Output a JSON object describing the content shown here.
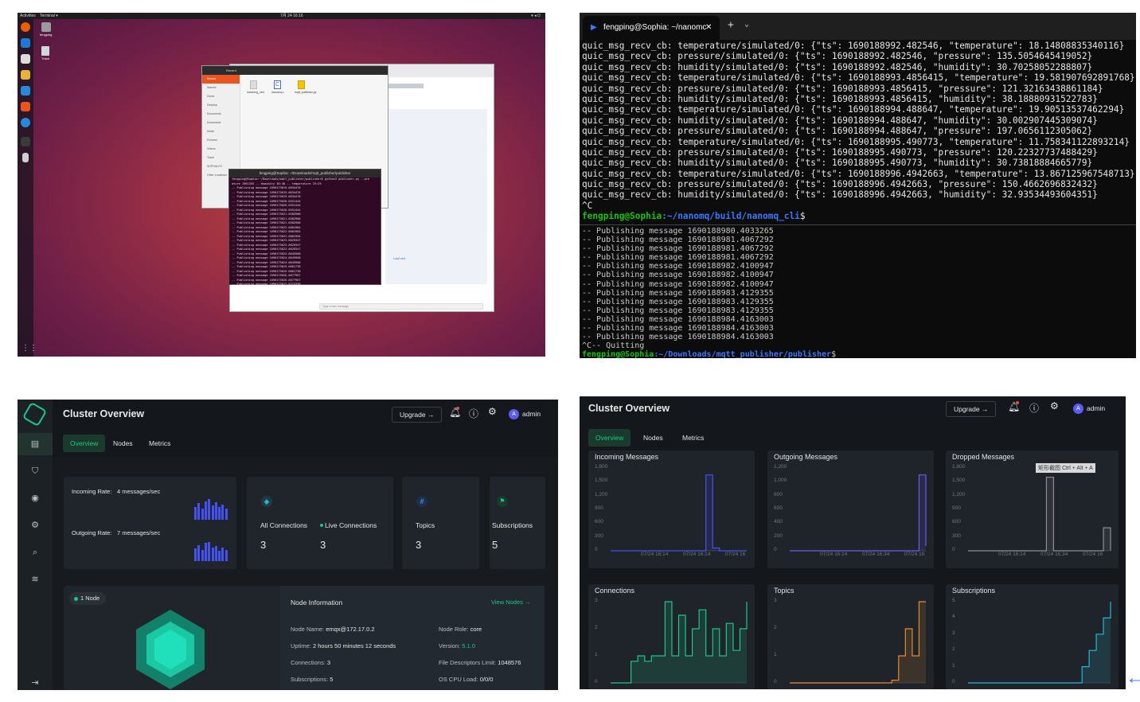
{
  "desktop": {
    "topbar": {
      "activities": "Activities",
      "app": "Terminal ▾",
      "clock": "7月 24 16:16"
    },
    "desktop_icons": [
      "fengping",
      "Trash"
    ],
    "files_window": {
      "title": "Recent",
      "sidebar": [
        "Recent",
        "Starred",
        "Home",
        "Desktop",
        "Documents",
        "Downloads",
        "Music",
        "Pictures",
        "Videos",
        "Trash",
        "SOPHIA-PC",
        "Other Locations"
      ],
      "files": [
        "incoming_cert",
        "nanomq.c",
        "mqtt_publisher.py"
      ]
    },
    "terminal_window": {
      "title": "fengping@Sophia: ~/Downloads/mqtt_publisher/publisher",
      "lines": [
        "fengping@Sophia:~/Downloads/mqtt_publisher/publisher$ python3 publisher.py --pre",
        "ature 1901355 -- Humidity 30:48 -- temperature 19:29",
        "-- Publishing message 1690175619.6634476",
        "-- Publishing message 1690175619.6634476",
        "-- Publishing message 1690175619.6634476",
        "-- Publishing message 1690175620.6551444",
        "-- Publishing message 1690175620.6551444",
        "-- Publishing message 1690175620.6551444",
        "-- Publishing message 1690175621.6582986",
        "-- Publishing message 1690175621.6582986",
        "-- Publishing message 1690175621.6582986",
        "-- Publishing message 1690175622.6601984",
        "-- Publishing message 1690175622.6601984",
        "-- Publishing message 1690175622.6601984",
        "-- Publishing message 1690175623.6629347",
        "-- Publishing message 1690175623.6629347",
        "-- Publishing message 1690175623.6629347",
        "-- Publishing message 1690175624.6645908",
        "-- Publishing message 1690175624.6645908",
        "-- Publishing message 1690175624.6645908",
        "-- Publishing message 1690175625.6661738",
        "-- Publishing message 1690175625.6661738",
        "-- Publishing message 1690175626.6677967",
        "-- Publishing message 1690175626.6677967",
        "-- Publishing message 1690175627.6713330"
      ]
    },
    "browser": {
      "message_placeholder": "Type a new message",
      "link": "Load next"
    }
  },
  "terminal": {
    "tab_title": "fengping@Sophia: ~/nanomc",
    "lines": [
      "quic_msg_recv_cb: temperature/simulated/0: {\"ts\": 1690188992.482546, \"temperature\": 18.14808835340116}",
      "quic_msg_recv_cb: pressure/simulated/0: {\"ts\": 1690188992.482546, \"pressure\": 135.5054645419052}",
      "quic_msg_recv_cb: humidity/simulated/0: {\"ts\": 1690188992.482546, \"humidity\": 30.70258052288807}",
      "quic_msg_recv_cb: temperature/simulated/0: {\"ts\": 1690188993.4856415, \"temperature\": 19.581907692891768}",
      "quic_msg_recv_cb: pressure/simulated/0: {\"ts\": 1690188993.4856415, \"pressure\": 121.32163438861184}",
      "quic_msg_recv_cb: humidity/simulated/0: {\"ts\": 1690188993.4856415, \"humidity\": 38.18880931522783}",
      "quic_msg_recv_cb: temperature/simulated/0: {\"ts\": 1690188994.488647, \"temperature\": 19.90513537462294}",
      "quic_msg_recv_cb: humidity/simulated/0: {\"ts\": 1690188994.488647, \"humidity\": 30.002907445309074}",
      "quic_msg_recv_cb: pressure/simulated/0: {\"ts\": 1690188994.488647, \"pressure\": 197.0656112305062}",
      "quic_msg_recv_cb: temperature/simulated/0: {\"ts\": 1690188995.490773, \"temperature\": 11.758341122893214}",
      "quic_msg_recv_cb: pressure/simulated/0: {\"ts\": 1690188995.490773, \"pressure\": 120.22327737488429}",
      "quic_msg_recv_cb: humidity/simulated/0: {\"ts\": 1690188995.490773, \"humidity\": 30.73818884665779}",
      "quic_msg_recv_cb: temperature/simulated/0: {\"ts\": 1690188996.4942663, \"temperature\": 13.867125967548713}",
      "quic_msg_recv_cb: pressure/simulated/0: {\"ts\": 1690188996.4942663, \"pressure\": 150.4662696832432}",
      "quic_msg_recv_cb: humidity/simulated/0: {\"ts\": 1690188996.4942663, \"humidity\": 32.93534493604351}",
      "^C"
    ],
    "prompt1_user": "fengping@Sophia",
    "prompt1_path": ":~/nanomq/build/nanomq_cli",
    "prompt1_end": "$",
    "pub_lines": [
      "-- Publishing message 1690188980.4033265",
      "-- Publishing message 1690188981.4067292",
      "-- Publishing message 1690188981.4067292",
      "-- Publishing message 1690188981.4067292",
      "-- Publishing message 1690188982.4100947",
      "-- Publishing message 1690188982.4100947",
      "-- Publishing message 1690188982.4100947",
      "-- Publishing message 1690188983.4129355",
      "-- Publishing message 1690188983.4129355",
      "-- Publishing message 1690188983.4129355",
      "-- Publishing message 1690188984.4163003",
      "-- Publishing message 1690188984.4163003",
      "-- Publishing message 1690188984.4163003",
      "^C-- Quitting"
    ],
    "prompt2_user": "fengping@Sophia",
    "prompt2_path": ":~/Downloads/mqtt_publisher/publisher",
    "prompt2_end": "$"
  },
  "overview": {
    "title": "Cluster Overview",
    "upgrade": "Upgrade",
    "user": "admin",
    "avatar_letter": "A",
    "tabs": [
      "Overview",
      "Nodes",
      "Metrics"
    ],
    "incoming_rate_label": "Incoming Rate:",
    "incoming_rate_value": "4 messages/sec",
    "outgoing_rate_label": "Outgoing Rate:",
    "outgoing_rate_value": "7 messages/sec",
    "stats": [
      {
        "label": "All Connections",
        "value": "3"
      },
      {
        "label": "Live Connections",
        "value": "3"
      },
      {
        "label": "Topics",
        "value": "3"
      },
      {
        "label": "Subscriptions",
        "value": "5"
      }
    ],
    "node_badge": "1 Node",
    "node_info_title": "Node Information",
    "view_nodes": "View Nodes",
    "node_fields": {
      "name_label": "Node Name:",
      "name": "emqx@172.17.0.2",
      "role_label": "Node Role:",
      "role": "core",
      "uptime_label": "Uptime:",
      "uptime": "2 hours 50 minutes 12 seconds",
      "version_label": "Version:",
      "version": "5.1.0",
      "conn_label": "Connections:",
      "conn": "3",
      "fd_label": "File Descriptors Limit:",
      "fd": "1048576",
      "subs_label": "Subscriptions:",
      "subs": "5",
      "cpu_label": "OS CPU Load:",
      "cpu": "0/0/0"
    },
    "colors": {
      "accent": "#1cc78a",
      "bars": "#4452f2",
      "bg": "#14181d"
    }
  },
  "metrics": {
    "title": "Cluster Overview",
    "upgrade": "Upgrade",
    "user": "admin",
    "avatar_letter": "A",
    "tabs": [
      "Overview",
      "Nodes",
      "Metrics"
    ],
    "screenshot_hint": "矩形截图 Ctrl + Alt + A"
  },
  "chart_data": [
    {
      "type": "line",
      "title": "Incoming Messages",
      "yticks": [
        "1,800",
        "1,500",
        "1,200",
        "900",
        "600",
        "300",
        "0"
      ],
      "ylim": [
        0,
        1800
      ],
      "xticks": [
        "07/24 16:14",
        "07/24 16:14",
        "07/24 16"
      ],
      "series": [
        {
          "values": [
            0,
            0,
            0,
            0,
            0,
            0,
            0,
            0,
            0,
            0,
            0,
            0,
            0,
            0,
            1650,
            60,
            0,
            0,
            0,
            0,
            0
          ],
          "color": "#4452f2"
        }
      ]
    },
    {
      "type": "line",
      "title": "Outgoing Messages",
      "yticks": [
        "1,200",
        "1,000",
        "800",
        "600",
        "400",
        "200",
        "0"
      ],
      "ylim": [
        0,
        1200
      ],
      "xticks": [
        "07/24 16:14",
        "07/24 16:34",
        "07/24 16"
      ],
      "series": [
        {
          "values": [
            0,
            0,
            0,
            0,
            0,
            0,
            0,
            0,
            0,
            0,
            0,
            0,
            0,
            0,
            0,
            0,
            0,
            0,
            0,
            1100,
            70
          ],
          "color": "#6a5bf0"
        }
      ]
    },
    {
      "type": "line",
      "title": "Dropped Messages",
      "yticks": [
        "1,800",
        "1,500",
        "1,200",
        "900",
        "600",
        "300",
        "0"
      ],
      "ylim": [
        0,
        1800
      ],
      "xticks": [
        "07/24 16:14",
        "07/24 16:34",
        "07/24 16"
      ],
      "series": [
        {
          "values": [
            0,
            0,
            0,
            0,
            0,
            0,
            0,
            0,
            0,
            0,
            0,
            1600,
            0,
            0,
            0,
            0,
            0,
            0,
            0,
            500,
            0
          ],
          "color": "#8a8f96"
        }
      ]
    },
    {
      "type": "line",
      "title": "Connections",
      "yticks": [
        "3",
        "2",
        "1",
        "0"
      ],
      "ylim": [
        0,
        3
      ],
      "series": [
        {
          "values": [
            0,
            0,
            0,
            0.8,
            1,
            0.8,
            1,
            1,
            3,
            1,
            2.5,
            1,
            2,
            2.7,
            1,
            2,
            1,
            2.2,
            1.2,
            2,
            3
          ],
          "color": "#1cc78a"
        }
      ]
    },
    {
      "type": "line",
      "title": "Topics",
      "yticks": [
        "3",
        "2",
        "1",
        "0"
      ],
      "ylim": [
        0,
        3
      ],
      "series": [
        {
          "values": [
            0,
            0,
            0,
            0,
            0,
            0,
            0,
            0,
            0,
            0,
            0,
            0,
            0,
            0,
            0,
            0.1,
            1,
            2,
            1,
            3,
            3
          ],
          "color": "#e68a2e"
        }
      ]
    },
    {
      "type": "line",
      "title": "Subscriptions",
      "yticks": [
        "5",
        "4",
        "3",
        "2",
        "1",
        "0"
      ],
      "ylim": [
        0,
        5
      ],
      "series": [
        {
          "values": [
            0,
            0,
            0,
            0,
            0,
            0,
            0,
            0,
            0,
            0,
            0,
            0,
            0,
            0,
            0,
            0,
            1,
            2,
            3,
            4,
            5
          ],
          "color": "#27b7d8"
        }
      ]
    }
  ]
}
